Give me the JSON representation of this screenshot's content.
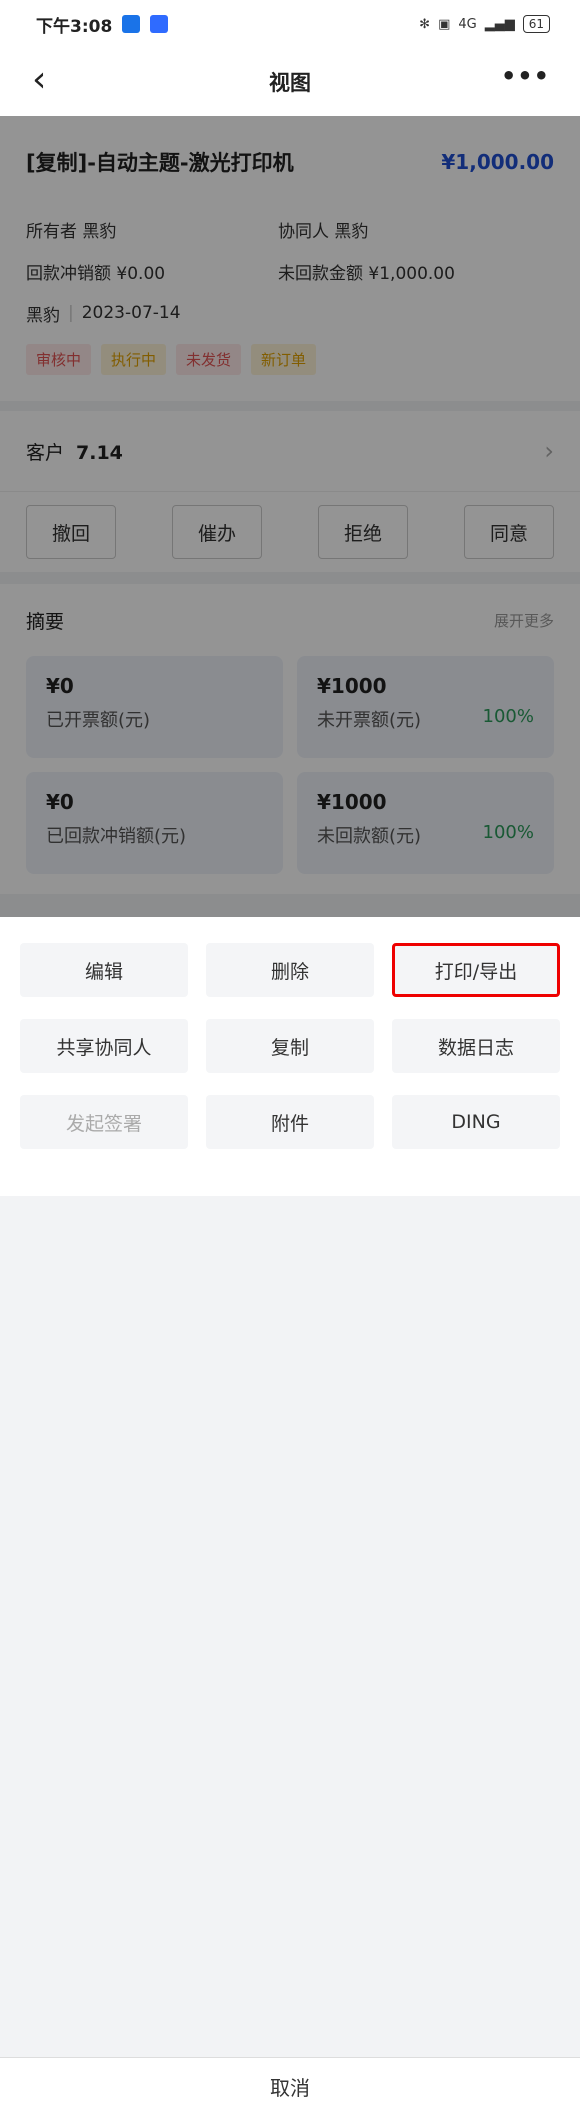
{
  "status": {
    "time": "下午3:08",
    "battery": "61",
    "network": "4G"
  },
  "nav": {
    "title": "视图"
  },
  "order": {
    "title": "[复制]-自动主题-激光打印机",
    "amount": "¥1,000.00",
    "owner_label": "所有者",
    "owner": "黑豹",
    "collab_label": "协同人",
    "collab": "黑豹",
    "writeoff_label": "回款冲销额",
    "writeoff": "¥0.00",
    "unpaid_label": "未回款金额",
    "unpaid": "¥1,000.00",
    "creator": "黑豹",
    "date": "2023-07-14",
    "tags": [
      {
        "text": "审核中",
        "color": "#e05252",
        "bg": "#fde8e8"
      },
      {
        "text": "执行中",
        "color": "#e0a000",
        "bg": "#fdf3d8"
      },
      {
        "text": "未发货",
        "color": "#e05252",
        "bg": "#fde8e8"
      },
      {
        "text": "新订单",
        "color": "#e0a000",
        "bg": "#fdf3d8"
      }
    ]
  },
  "customer": {
    "label": "客户",
    "name": "7.14"
  },
  "actions": [
    "撤回",
    "催办",
    "拒绝",
    "同意"
  ],
  "summary": {
    "title": "摘要",
    "more": "展开更多",
    "tiles": [
      {
        "value": "¥0",
        "label": "已开票额(元)",
        "pct": ""
      },
      {
        "value": "¥1000",
        "label": "未开票额(元)",
        "pct": "100%"
      },
      {
        "value": "¥0",
        "label": "已回款冲销额(元)",
        "pct": ""
      },
      {
        "value": "¥1000",
        "label": "未回款额(元)",
        "pct": "100%"
      }
    ]
  },
  "sheet": {
    "buttons": [
      "编辑",
      "删除",
      "打印/导出",
      "共享协同人",
      "复制",
      "数据日志",
      "发起签署",
      "附件",
      "DING"
    ],
    "cancel": "取消"
  }
}
